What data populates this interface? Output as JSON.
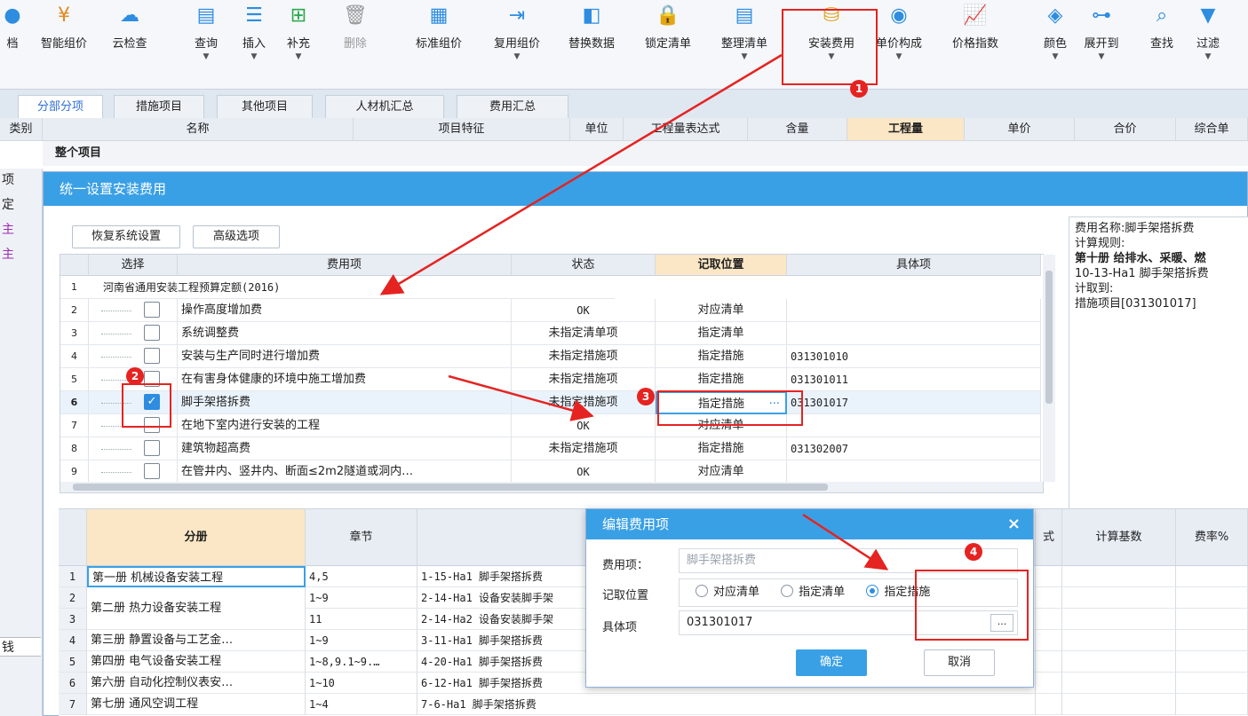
{
  "toolbar": {
    "items": [
      {
        "label": "档",
        "icon": "document-icon"
      },
      {
        "label": "智能组价",
        "icon": "smart-price-icon"
      },
      {
        "label": "云检查",
        "icon": "cloud-check-icon"
      },
      {
        "label": "查询",
        "icon": "query-icon"
      },
      {
        "label": "插入",
        "icon": "insert-icon"
      },
      {
        "label": "补充",
        "icon": "supplement-icon"
      },
      {
        "label": "删除",
        "icon": "delete-icon"
      },
      {
        "label": "标准组价",
        "icon": "standard-price-icon"
      },
      {
        "label": "复用组价",
        "icon": "reuse-price-icon"
      },
      {
        "label": "替换数据",
        "icon": "replace-data-icon"
      },
      {
        "label": "锁定清单",
        "icon": "lock-list-icon"
      },
      {
        "label": "整理清单",
        "icon": "organize-list-icon"
      },
      {
        "label": "安装费用",
        "icon": "install-fee-icon"
      },
      {
        "label": "单价构成",
        "icon": "unit-price-icon"
      },
      {
        "label": "价格指数",
        "icon": "price-index-icon"
      },
      {
        "label": "颜色",
        "icon": "color-icon"
      },
      {
        "label": "展开到",
        "icon": "expand-icon"
      },
      {
        "label": "查找",
        "icon": "find-icon"
      },
      {
        "label": "过滤",
        "icon": "filter-icon"
      }
    ]
  },
  "tabs": [
    "分部分项",
    "措施项目",
    "其他项目",
    "人材机汇总",
    "费用汇总"
  ],
  "main_grid": {
    "columns": [
      "类别",
      "名称",
      "项目特征",
      "单位",
      "工程量表达式",
      "含量",
      "工程量",
      "单价",
      "合价",
      "综合单"
    ],
    "row1_name": "整个项目"
  },
  "left_column": [
    "项",
    "定",
    "主",
    "主",
    "钱"
  ],
  "dialog": {
    "title": "统一设置安装费用",
    "restore_button": "恢复系统设置",
    "advanced_button": "高级选项",
    "columns": [
      "选择",
      "费用项",
      "状态",
      "记取位置",
      "具体项"
    ],
    "rows": [
      {
        "n": "1",
        "name": "河南省通用安装工程预算定额(2016)",
        "status": "",
        "pos": "",
        "item": "",
        "checked": false
      },
      {
        "n": "2",
        "name": "操作高度增加费",
        "status": "OK",
        "pos": "对应清单",
        "item": "",
        "checked": false
      },
      {
        "n": "3",
        "name": "系统调整费",
        "status": "未指定清单项",
        "pos": "指定清单",
        "item": "",
        "checked": false
      },
      {
        "n": "4",
        "name": "安装与生产同时进行增加费",
        "status": "未指定措施项",
        "pos": "指定措施",
        "item": "031301010",
        "checked": false
      },
      {
        "n": "5",
        "name": "在有害身体健康的环境中施工增加费",
        "status": "未指定措施项",
        "pos": "指定措施",
        "item": "031301011",
        "checked": false
      },
      {
        "n": "6",
        "name": "脚手架搭拆费",
        "status": "未指定措施项",
        "pos": "指定措施",
        "item": "031301017",
        "checked": true
      },
      {
        "n": "7",
        "name": "在地下室内进行安装的工程",
        "status": "OK",
        "pos": "对应清单",
        "item": "",
        "checked": false
      },
      {
        "n": "8",
        "name": "建筑物超高费",
        "status": "未指定措施项",
        "pos": "指定措施",
        "item": "031302007",
        "checked": false
      },
      {
        "n": "9",
        "name": "在管井内、竖井内、断面≤2m2隧道或洞内…",
        "status": "OK",
        "pos": "对应清单",
        "item": "",
        "checked": false
      }
    ],
    "info": {
      "name_line": "费用名称:脚手架搭拆费",
      "rule_label": "计算规则:",
      "rule_text": "第十册 给排水、采暖、燃",
      "rule_code": "10-13-Ha1 脚手架搭拆费",
      "target_label": "计取到:",
      "target": "措施项目[031301017]"
    }
  },
  "lower_grid": {
    "columns": [
      "分册",
      "章节",
      "",
      "式",
      "计算基数",
      "费率%"
    ],
    "rows": [
      {
        "n": "1",
        "book": "第一册 机械设备安装工程",
        "chapter": "4,5",
        "item": "1-15-Ha1 脚手架搭拆费"
      },
      {
        "n": "2",
        "book": "第二册 热力设备安装工程",
        "chapter": "1~9",
        "item": "2-14-Ha1 设备安装脚手架"
      },
      {
        "n": "3",
        "book": "",
        "chapter": "11",
        "item": "2-14-Ha2 设备安装脚手架"
      },
      {
        "n": "4",
        "book": "第三册 静置设备与工艺金…",
        "chapter": "1~9",
        "item": "3-11-Ha1 脚手架搭拆费"
      },
      {
        "n": "5",
        "book": "第四册 电气设备安装工程",
        "chapter": "1~8,9.1~9.…",
        "item": "4-20-Ha1 脚手架搭拆费"
      },
      {
        "n": "6",
        "book": "第六册 自动化控制仪表安…",
        "chapter": "1~10",
        "item": "6-12-Ha1 脚手架搭拆费"
      },
      {
        "n": "7",
        "book": "第七册 通风空调工程",
        "chapter": "1~4",
        "item": "7-6-Ha1 脚手架搭拆费"
      }
    ]
  },
  "edit_dialog": {
    "title": "编辑费用项",
    "close": "×",
    "fee_label": "费用项：",
    "fee_value": "脚手架搭拆费",
    "pos_label": "记取位置",
    "options": [
      "对应清单",
      "指定清单",
      "指定措施"
    ],
    "selected": "指定措施",
    "item_label": "具体项",
    "item_value": "031301017",
    "browse": "...",
    "ok": "确定",
    "cancel": "取消"
  },
  "annotations": {
    "badges": [
      "1",
      "2",
      "3",
      "4"
    ],
    "color": "#e52321"
  },
  "colors": {
    "accent": "#3aa0e5",
    "highlight_header": "#fbe7c6",
    "annotation": "#e52321"
  }
}
